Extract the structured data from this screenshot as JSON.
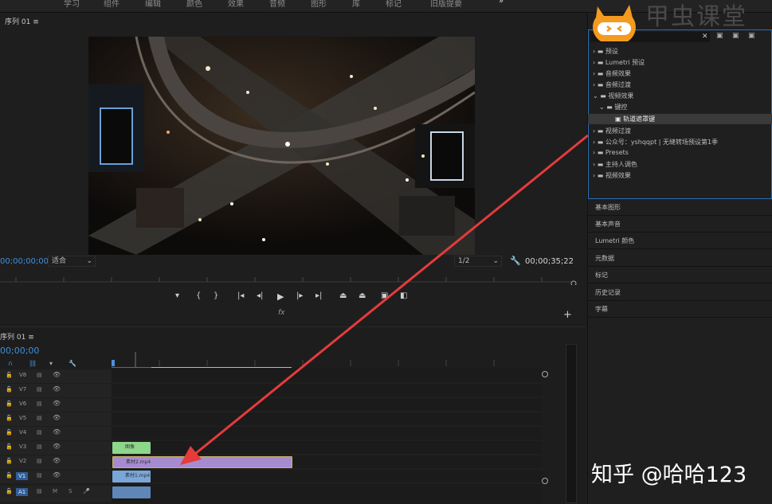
{
  "menu": [
    "学习",
    "组件",
    "编辑",
    "颜色",
    "效果",
    "音频",
    "图形",
    "库",
    "标记",
    "旧版提要"
  ],
  "program": {
    "title": "序列 01",
    "timecode_current": "00;00;00;00",
    "fit": "适合",
    "resolution": "1/2",
    "timecode_duration": "00;00;35;22",
    "fx_label": "fx"
  },
  "timeline": {
    "title": "序列 01",
    "timecode": "00;00;00",
    "tracks": [
      "V8",
      "V7",
      "V6",
      "V5",
      "V4",
      "V3",
      "V2",
      "V1",
      "A1"
    ],
    "clips": {
      "v3": "图像",
      "v2": "素材2.mp4",
      "v1": "素材1.mp4"
    }
  },
  "effects": {
    "search": "",
    "tree": [
      {
        "label": "预设",
        "level": 0
      },
      {
        "label": "Lumetri 预设",
        "level": 0
      },
      {
        "label": "音频效果",
        "level": 0
      },
      {
        "label": "音频过渡",
        "level": 0
      },
      {
        "label": "视频效果",
        "level": 0,
        "open": true
      },
      {
        "label": "键控",
        "level": 1,
        "open": true
      },
      {
        "label": "轨道遮罩键",
        "level": 2,
        "selected": true
      },
      {
        "label": "视频过渡",
        "level": 0
      },
      {
        "label": "公众号：yshqqpt | 无缝转场预设第1季",
        "level": 0
      },
      {
        "label": "Presets",
        "level": 0
      },
      {
        "label": "主持人调色",
        "level": 0
      },
      {
        "label": "视频效果",
        "level": 0
      }
    ]
  },
  "panels": [
    "基本图形",
    "基本声音",
    "Lumetri 颜色",
    "元数据",
    "标记",
    "历史记录",
    "字幕"
  ],
  "brand": "甲虫课堂",
  "watermark": "知乎 @哈哈123",
  "colors": {
    "accent": "#3d8fe0",
    "clip_purple": "#a78bd0",
    "clip_green": "#8ed68b",
    "arrow": "#e53b3b"
  }
}
